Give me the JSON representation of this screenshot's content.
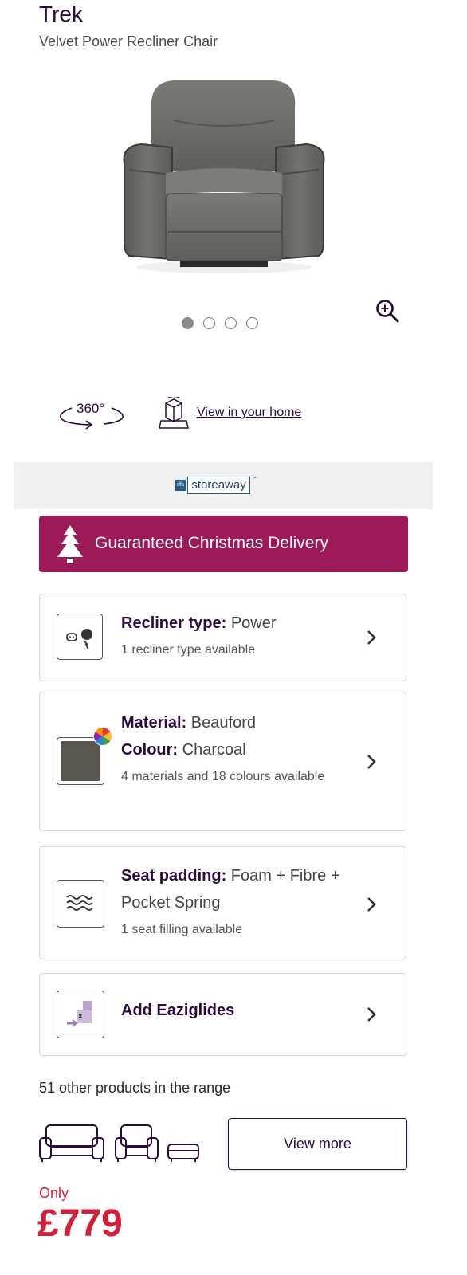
{
  "product": {
    "name": "Trek",
    "subtitle": "Velvet Power Recliner Chair"
  },
  "gallery": {
    "slide_count": 4,
    "active_index": 0
  },
  "viewer": {
    "label_360": "360°",
    "ar_link": "View in your home"
  },
  "storeaway": {
    "badge": "dfs",
    "text": "storeaway",
    "tm": "™"
  },
  "banner": {
    "text": "Guaranteed Christmas Delivery",
    "color": "#9c1a57"
  },
  "options": {
    "recliner": {
      "label": "Recliner type:",
      "value": " Power",
      "sub": "1 recliner type available"
    },
    "material": {
      "label": "Material:",
      "value": " Beauford",
      "colour_label": "Colour:",
      "colour_value": " Charcoal",
      "sub": "4 materials and 18 colours available",
      "swatch_color": "#5c5650"
    },
    "padding": {
      "label": "Seat padding:",
      "value": " Foam + Fibre + Pocket Spring",
      "sub": "1 seat filling available"
    },
    "eaziglides": {
      "label": "Add Eaziglides"
    }
  },
  "range": {
    "text": "51 other products in the range",
    "view_more": "View more"
  },
  "pricing": {
    "prefix": "Only",
    "price": "£779",
    "color": "#d41f3b"
  }
}
